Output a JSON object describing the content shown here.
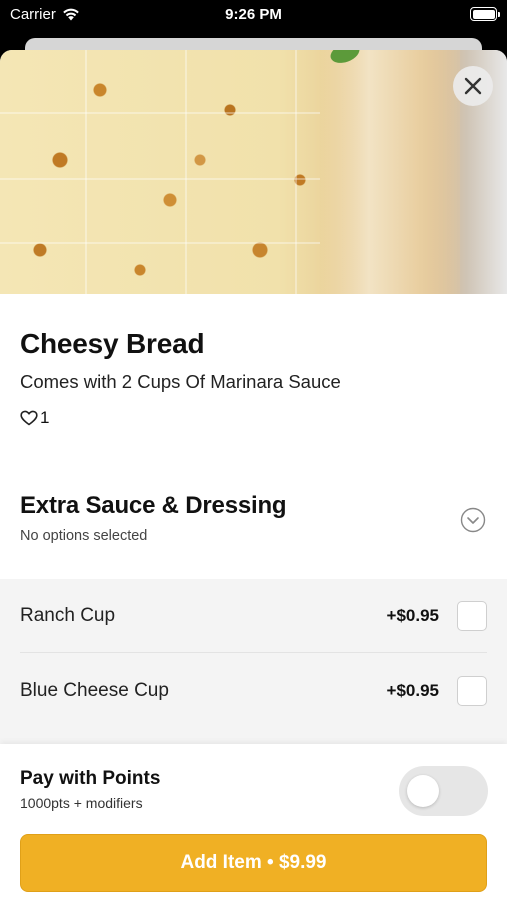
{
  "status_bar": {
    "carrier": "Carrier",
    "time": "9:26 PM",
    "wifi_icon": "wifi-icon",
    "battery_icon": "battery-icon"
  },
  "product": {
    "image_icon": "cheesy-bread-photo",
    "title": "Cheesy Bread",
    "description": "Comes with 2 Cups Of Marinara Sauce",
    "like_icon": "heart-outline-icon",
    "likes": "1"
  },
  "close_icon": "close-icon",
  "modifier_group": {
    "title": "Extra Sauce & Dressing",
    "subtitle": "No options selected",
    "expand_icon": "chevron-down-circle-icon",
    "options": [
      {
        "name": "Ranch Cup",
        "price": "+$0.95",
        "checked": false
      },
      {
        "name": "Blue Cheese Cup",
        "price": "+$0.95",
        "checked": false
      }
    ]
  },
  "points": {
    "title": "Pay with Points",
    "subtitle": "1000pts + modifiers",
    "enabled": false
  },
  "add_button": {
    "label": "Add Item • $9.99"
  },
  "colors": {
    "accent": "#f0b024",
    "toggle_off": "#e6e6e6",
    "options_bg": "#f4f4f4"
  }
}
